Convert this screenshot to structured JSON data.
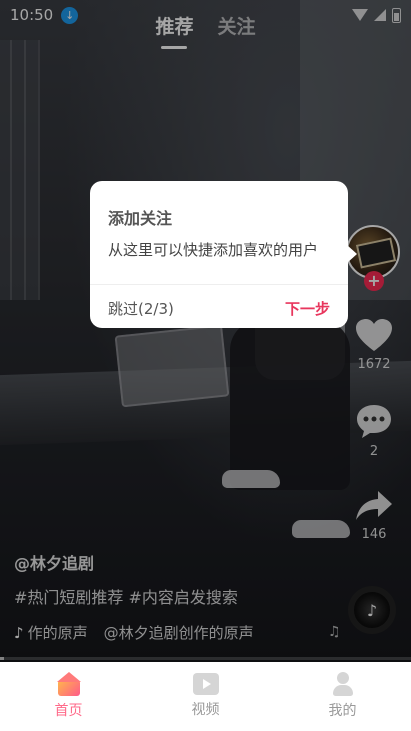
{
  "status_bar": {
    "time": "10:50",
    "download_icon": "download-icon"
  },
  "top_tabs": [
    {
      "label": "推荐",
      "active": true
    },
    {
      "label": "关注",
      "active": false
    }
  ],
  "popup": {
    "title": "添加关注",
    "body": "从这里可以快捷添加喜欢的用户",
    "skip_label": "跳过(2/3)",
    "next_label": "下一步",
    "next_color": "#e8365d"
  },
  "rail": {
    "follow_plus": "+",
    "like_count": "1672",
    "comment_count": "2",
    "share_count": "146"
  },
  "video_info": {
    "author": "@林夕追剧",
    "description": "#热门短剧推荐 #内容启发搜索",
    "music_prefix": "作的原声",
    "music_text": "@林夕追剧创作的原声"
  },
  "progress": 0.01,
  "bottom_nav": [
    {
      "label": "首页",
      "icon": "home-icon",
      "active": true
    },
    {
      "label": "视频",
      "icon": "video-icon",
      "active": false
    },
    {
      "label": "我的",
      "icon": "user-icon",
      "active": false
    }
  ],
  "colors": {
    "accent": "#fe2c55",
    "nav_active": "#ff6a8a"
  }
}
